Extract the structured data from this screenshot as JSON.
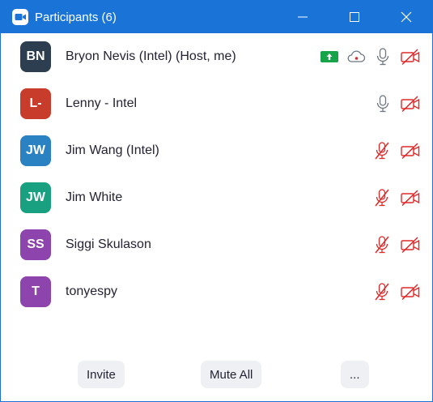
{
  "titlebar": {
    "title": "Participants (6)",
    "accent": "#1a74d8"
  },
  "participants": [
    {
      "initials": "BN",
      "name": "Bryon Nevis (Intel) (Host, me)",
      "avatar_color": "#2d3e50",
      "audio": "on",
      "video": "off",
      "extra_icons": [
        "share-screen-icon",
        "cloud-record-icon"
      ]
    },
    {
      "initials": "L-",
      "name": "Lenny - Intel",
      "avatar_color": "#c83c2c",
      "audio": "on",
      "video": "off",
      "extra_icons": []
    },
    {
      "initials": "JW",
      "name": "Jim Wang (Intel)",
      "avatar_color": "#2a82c3",
      "audio": "muted",
      "video": "off",
      "extra_icons": []
    },
    {
      "initials": "JW",
      "name": "Jim White",
      "avatar_color": "#18a080",
      "audio": "muted",
      "video": "off",
      "extra_icons": []
    },
    {
      "initials": "SS",
      "name": "Siggi Skulason",
      "avatar_color": "#8e44ad",
      "audio": "muted",
      "video": "off",
      "extra_icons": []
    },
    {
      "initials": "T",
      "name": "tonyespy",
      "avatar_color": "#8e44ad",
      "audio": "muted",
      "video": "off",
      "extra_icons": []
    }
  ],
  "footer": {
    "invite_label": "Invite",
    "mute_all_label": "Mute All",
    "more_label": "..."
  },
  "colors": {
    "muted_red": "#e02828",
    "icon_gray": "#6e7680",
    "share_green": "#16a34a"
  }
}
